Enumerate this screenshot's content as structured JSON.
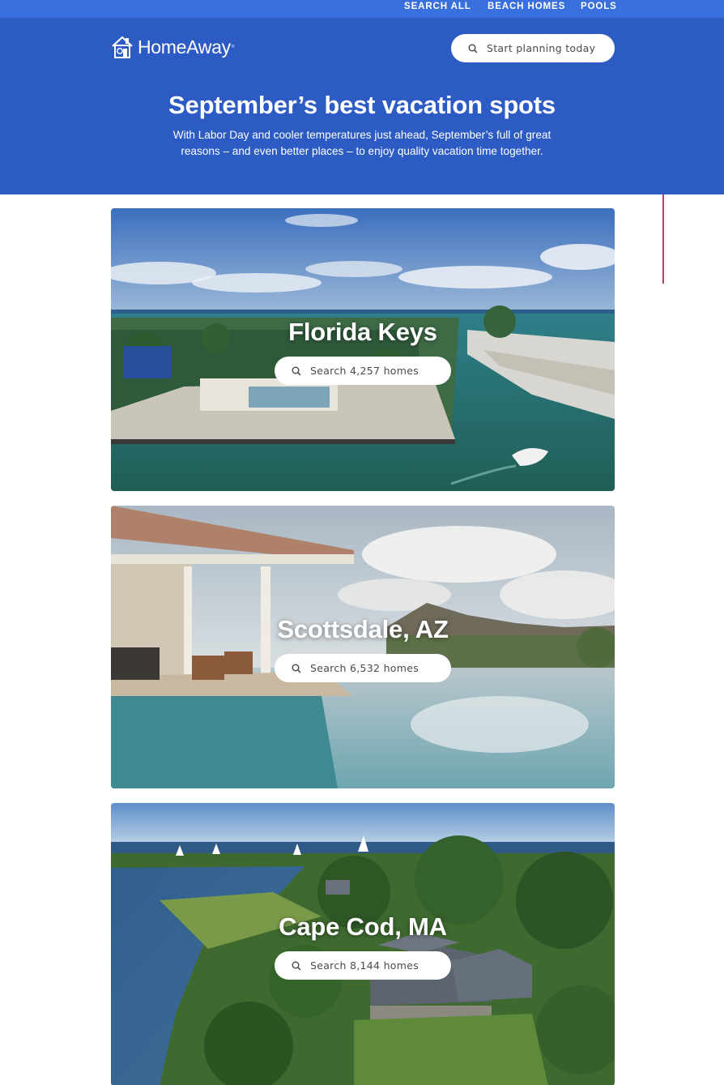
{
  "nav": {
    "links": [
      "SEARCH ALL",
      "BEACH HOMES",
      "POOLS"
    ]
  },
  "brand": {
    "name": "HomeAway",
    "mark": "®"
  },
  "header_search": {
    "label": "Start planning today",
    "icon": "search-icon"
  },
  "hero": {
    "title": "September’s best vacation spots",
    "subtitle": "With Labor Day and cooler temperatures just ahead, September’s full of great reasons – and even better places – to enjoy quality vacation time together."
  },
  "destinations": [
    {
      "name": "Florida Keys",
      "search_label": "Search 4,257 homes"
    },
    {
      "name": "Scottsdale, AZ",
      "search_label": "Search 6,532 homes"
    },
    {
      "name": "Cape Cod, MA",
      "search_label": "Search 8,144 homes"
    }
  ],
  "colors": {
    "topnav": "#3a70dd",
    "hero": "#2c5bc4",
    "accent_line": "#c23b6e"
  }
}
